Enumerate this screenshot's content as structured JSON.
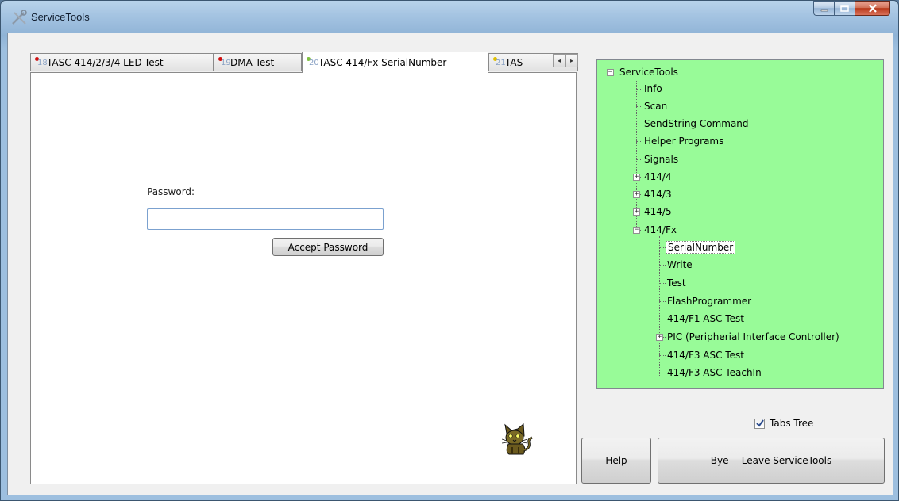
{
  "window": {
    "title": "ServiceTools",
    "minimize_icon": "minimize-icon",
    "maximize_icon": "maximize-icon",
    "close_icon": "close-icon"
  },
  "tabs": [
    {
      "number": "18",
      "label": "TASC 414/2/3/4 LED-Test",
      "active": false
    },
    {
      "number": "19",
      "label": "DMA Test",
      "active": false
    },
    {
      "number": "20",
      "label": "TASC 414/Fx SerialNumber",
      "active": true
    },
    {
      "number": "21",
      "label": "TAS",
      "active": false
    }
  ],
  "tab_scroll": {
    "left": "◂",
    "right": "▸"
  },
  "password_panel": {
    "label": "Password:",
    "value": "",
    "accept_button": "Accept Password"
  },
  "tree": {
    "root": "ServiceTools",
    "items": [
      {
        "label": "Info"
      },
      {
        "label": "Scan"
      },
      {
        "label": "SendString Command"
      },
      {
        "label": "Helper Programs"
      },
      {
        "label": "Signals"
      },
      {
        "label": "414/4",
        "expander": "+"
      },
      {
        "label": "414/3",
        "expander": "+"
      },
      {
        "label": "414/5",
        "expander": "+"
      },
      {
        "label": "414/Fx",
        "expander": "−"
      }
    ],
    "fx_children": [
      {
        "label": "SerialNumber",
        "selected": true
      },
      {
        "label": "Write"
      },
      {
        "label": "Test"
      },
      {
        "label": "FlashProgrammer"
      },
      {
        "label": "414/F1 ASC Test"
      },
      {
        "label": "PIC (Peripherial Interface Controller)",
        "expander": "+"
      },
      {
        "label": "414/F3 ASC Test"
      },
      {
        "label": "414/F3 ASC TeachIn"
      }
    ]
  },
  "controls": {
    "tabs_tree_label": "Tabs Tree",
    "tabs_tree_checked": true,
    "help_button": "Help",
    "bye_button": "Bye -- Leave ServiceTools"
  },
  "colors": {
    "tree_background": "#98fb98",
    "titlebar": "#a5c4e2"
  }
}
